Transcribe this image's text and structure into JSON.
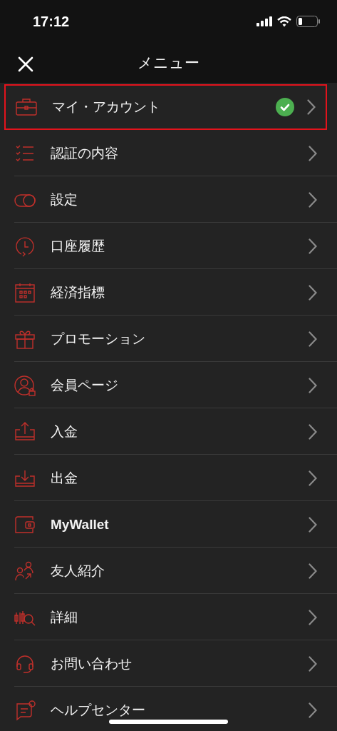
{
  "status_bar": {
    "time": "17:12"
  },
  "header": {
    "title": "メニュー"
  },
  "items": [
    {
      "label": "マイ・アカウント",
      "bold": false,
      "verified": true,
      "highlighted": true
    },
    {
      "label": "認証の内容",
      "bold": false,
      "verified": false,
      "highlighted": false
    },
    {
      "label": "設定",
      "bold": false,
      "verified": false,
      "highlighted": false
    },
    {
      "label": "口座履歴",
      "bold": false,
      "verified": false,
      "highlighted": false
    },
    {
      "label": "経済指標",
      "bold": false,
      "verified": false,
      "highlighted": false
    },
    {
      "label": "プロモーション",
      "bold": false,
      "verified": false,
      "highlighted": false
    },
    {
      "label": "会員ページ",
      "bold": false,
      "verified": false,
      "highlighted": false
    },
    {
      "label": "入金",
      "bold": false,
      "verified": false,
      "highlighted": false
    },
    {
      "label": "出金",
      "bold": false,
      "verified": false,
      "highlighted": false
    },
    {
      "label": "MyWallet",
      "bold": true,
      "verified": false,
      "highlighted": false
    },
    {
      "label": "友人紹介",
      "bold": false,
      "verified": false,
      "highlighted": false
    },
    {
      "label": "詳細",
      "bold": false,
      "verified": false,
      "highlighted": false
    },
    {
      "label": "お問い合わせ",
      "bold": false,
      "verified": false,
      "highlighted": false
    },
    {
      "label": "ヘルプセンター",
      "bold": false,
      "verified": false,
      "highlighted": false
    }
  ]
}
